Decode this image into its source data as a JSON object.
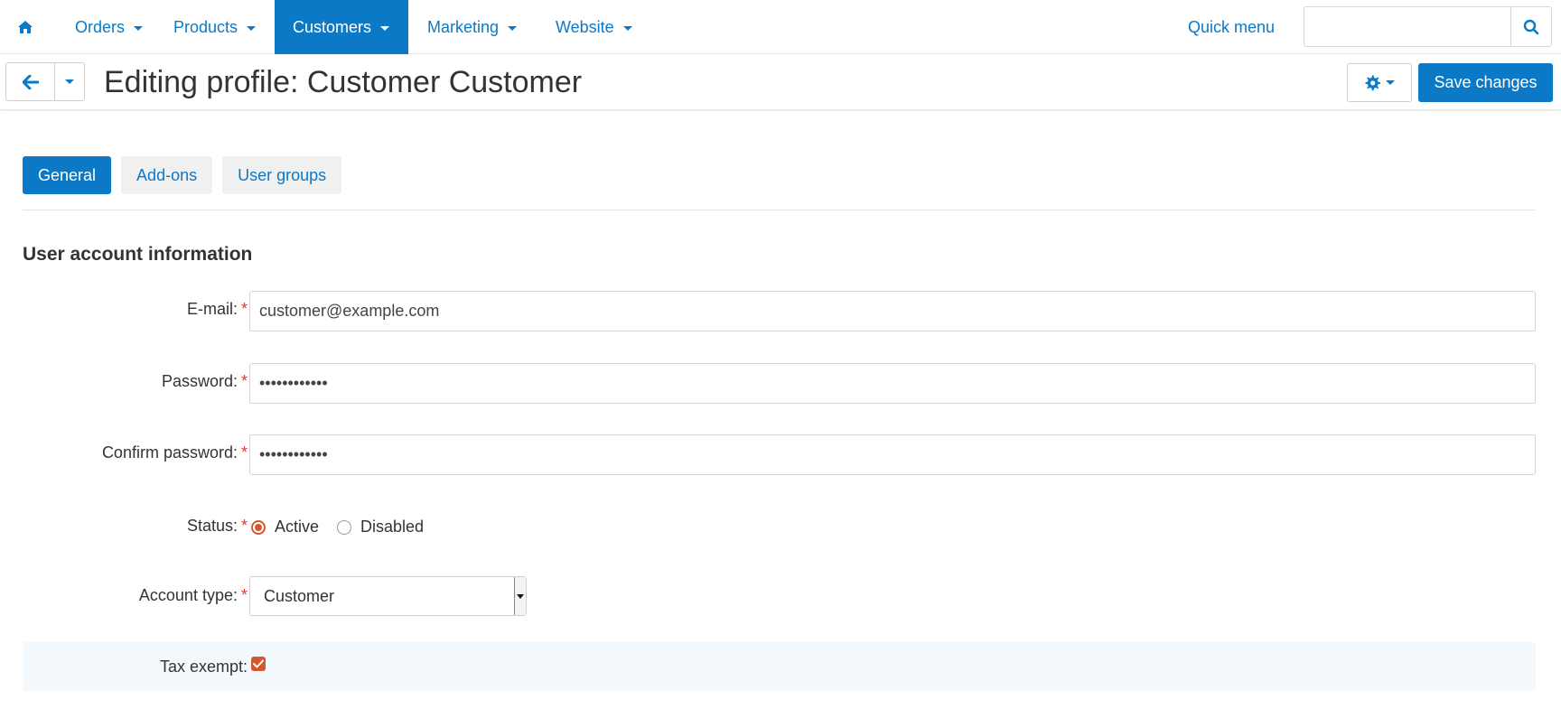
{
  "nav": {
    "home_icon": "home-icon",
    "items": [
      {
        "label": "Orders"
      },
      {
        "label": "Products"
      },
      {
        "label": "Customers"
      },
      {
        "label": "Marketing"
      },
      {
        "label": "Website"
      }
    ],
    "active_item": "Customers",
    "quick_menu_label": "Quick menu",
    "search": {
      "value": "",
      "placeholder": "",
      "icon": "search-icon"
    }
  },
  "header": {
    "back_icon": "arrow-left-icon",
    "title": "Editing profile: Customer Customer",
    "settings_icon": "gear-icon",
    "save_label": "Save changes"
  },
  "tabs": [
    {
      "label": "General",
      "active": true
    },
    {
      "label": "Add-ons",
      "active": false
    },
    {
      "label": "User groups",
      "active": false
    }
  ],
  "section": {
    "title": "User account information"
  },
  "form": {
    "email": {
      "label": "E-mail:",
      "required": "*",
      "value": "customer@example.com"
    },
    "password": {
      "label": "Password:",
      "required": "*",
      "value": "••••••••••••"
    },
    "confirm_password": {
      "label": "Confirm password:",
      "required": "*",
      "value": "••••••••••••"
    },
    "status": {
      "label": "Status:",
      "required": "*",
      "options": [
        "Active",
        "Disabled"
      ],
      "selected": "Active"
    },
    "account_type": {
      "label": "Account type:",
      "required": "*",
      "value": "Customer"
    },
    "tax_exempt": {
      "label": "Tax exempt:",
      "checked": true
    }
  },
  "colors": {
    "accent": "#0b79c6",
    "required": "#e03a3a",
    "checked": "#d1582f",
    "row_highlight": "#f3f9fc"
  }
}
